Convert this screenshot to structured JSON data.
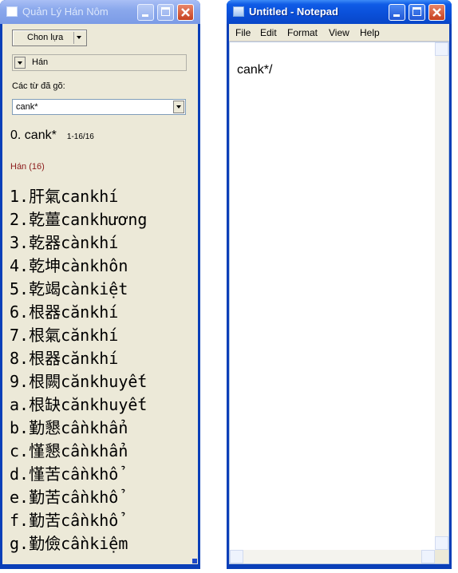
{
  "left_window": {
    "title": "Quản Lý Hán Nôm",
    "menu_button": "Chon lựa",
    "script_combo": "Hán",
    "typed_label": "Các từ đã gõ:",
    "typed_value": "cank*",
    "query": "0. cank*",
    "range": "1-16/16",
    "section_label": "Hán (16)",
    "section_color": "#8b1a1a",
    "results": [
      {
        "idx": "1.",
        "han": "肝氣",
        "reading": "cankhí"
      },
      {
        "idx": "2.",
        "han": "乾薑",
        "reading": "cankhương"
      },
      {
        "idx": "3.",
        "han": "乾器",
        "reading": "cànkhí"
      },
      {
        "idx": "4.",
        "han": "乾坤",
        "reading": "cànkhôn"
      },
      {
        "idx": "5.",
        "han": "乾竭",
        "reading": "cànkiệt"
      },
      {
        "idx": "6.",
        "han": "根器",
        "reading": "cănkhí"
      },
      {
        "idx": "7.",
        "han": "根氣",
        "reading": "cănkhí"
      },
      {
        "idx": "8.",
        "han": "根器",
        "reading": "cănkhí"
      },
      {
        "idx": "9.",
        "han": "根闕",
        "reading": "cănkhuyết"
      },
      {
        "idx": "a.",
        "han": "根缺",
        "reading": "cănkhuyết"
      },
      {
        "idx": "b.",
        "han": "勤懇",
        "reading": "cầnkhẩn"
      },
      {
        "idx": "c.",
        "han": "慬懇",
        "reading": "cầnkhẩn"
      },
      {
        "idx": "d.",
        "han": "慬苦",
        "reading": "cầnkhổ"
      },
      {
        "idx": "e.",
        "han": "勤苦",
        "reading": "cầnkhổ"
      },
      {
        "idx": "f.",
        "han": "勤苦",
        "reading": "cầnkhổ"
      },
      {
        "idx": "g.",
        "han": "勤儉",
        "reading": "cầnkiệm"
      }
    ]
  },
  "notepad": {
    "title": "Untitled - Notepad",
    "menu": [
      "File",
      "Edit",
      "Format",
      "View",
      "Help"
    ],
    "content": "cank*/"
  },
  "icons": [
    "app-window-icon",
    "notepad-icon",
    "minimize-icon",
    "maximize-icon",
    "close-icon",
    "dropdown-arrow-icon",
    "resize-grip-icon"
  ],
  "colors": {
    "titlebar_blue": "#0a4fd8",
    "face": "#ece9d8",
    "close_red": "#c6401f"
  }
}
